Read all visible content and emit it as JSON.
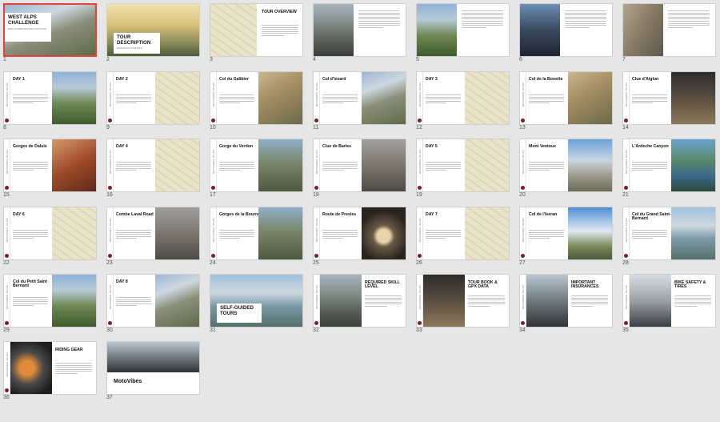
{
  "app": {
    "panel": "Slide Sorter"
  },
  "colors": {
    "accent": "#e8413a",
    "brand_dot": "#7a1f2b"
  },
  "brand_strip": "MOTOVIBES TOURS",
  "slides": [
    {
      "n": "1",
      "layout": "cover",
      "title": "WEST ALPS CHALLENGE",
      "sub": "SELF-GUIDED MOTORCYCLE TOUR",
      "photo": "mountain"
    },
    {
      "n": "2",
      "layout": "cover2",
      "title": "TOUR DESCRIPTION",
      "sub": "HIGHLIGHTS & DETAILS",
      "photo": "sunrise"
    },
    {
      "n": "3",
      "layout": "overview",
      "title": "TOUR OVERVIEW",
      "sub": "",
      "photo": "map"
    },
    {
      "n": "4",
      "layout": "photo-left",
      "title": "",
      "sub": "",
      "photo": "road"
    },
    {
      "n": "5",
      "layout": "photo-left",
      "title": "",
      "sub": "",
      "photo": "valley"
    },
    {
      "n": "6",
      "layout": "photo-left",
      "title": "",
      "sub": "",
      "photo": "portrait"
    },
    {
      "n": "7",
      "layout": "photo-left",
      "title": "",
      "sub": "",
      "photo": "cliff"
    },
    {
      "n": "8",
      "layout": "title-photo",
      "title": "DAY 1",
      "sub": "",
      "photo": "valley"
    },
    {
      "n": "9",
      "layout": "title-photo",
      "title": "DAY 2",
      "sub": "",
      "photo": "map"
    },
    {
      "n": "10",
      "layout": "title-photo",
      "title": "Col du Galibier",
      "sub": "",
      "photo": "serpentine"
    },
    {
      "n": "11",
      "layout": "title-photo",
      "title": "Col d'Izoard",
      "sub": "",
      "photo": "mountain"
    },
    {
      "n": "12",
      "layout": "title-photo",
      "title": "DAY 3",
      "sub": "",
      "photo": "map"
    },
    {
      "n": "13",
      "layout": "title-photo",
      "title": "Col de la Bonette",
      "sub": "",
      "photo": "serpentine"
    },
    {
      "n": "14",
      "layout": "title-photo",
      "title": "Clue d'Aiglun",
      "sub": "",
      "photo": "bike"
    },
    {
      "n": "15",
      "layout": "title-photo",
      "title": "Gorges de Daluis",
      "sub": "",
      "photo": "red"
    },
    {
      "n": "16",
      "layout": "title-photo",
      "title": "DAY 4",
      "sub": "",
      "photo": "map"
    },
    {
      "n": "17",
      "layout": "title-photo",
      "title": "Gorge du Verdon",
      "sub": "",
      "photo": "gorge"
    },
    {
      "n": "18",
      "layout": "title-photo",
      "title": "Clue de Barles",
      "sub": "",
      "photo": "rock"
    },
    {
      "n": "19",
      "layout": "title-photo",
      "title": "DAY 5",
      "sub": "",
      "photo": "map"
    },
    {
      "n": "20",
      "layout": "title-photo",
      "title": "Mont Ventoux",
      "sub": "",
      "photo": "ventoux"
    },
    {
      "n": "21",
      "layout": "title-photo",
      "title": "L'Ardeche Canyon",
      "sub": "",
      "photo": "canyon"
    },
    {
      "n": "22",
      "layout": "title-photo",
      "title": "DAY 6",
      "sub": "",
      "photo": "map"
    },
    {
      "n": "23",
      "layout": "title-photo",
      "title": "Combe Laval Road",
      "sub": "",
      "photo": "rock"
    },
    {
      "n": "24",
      "layout": "title-photo",
      "title": "Gorges de la Bourne",
      "sub": "",
      "photo": "gorge"
    },
    {
      "n": "25",
      "layout": "title-photo",
      "title": "Route de Presles",
      "sub": "",
      "photo": "tunnel"
    },
    {
      "n": "26",
      "layout": "title-photo",
      "title": "DAY 7",
      "sub": "",
      "photo": "map"
    },
    {
      "n": "27",
      "layout": "title-photo",
      "title": "Col de l'Iseran",
      "sub": "",
      "photo": "snow"
    },
    {
      "n": "28",
      "layout": "title-photo",
      "title": "Col du Grand Saint-Bernard",
      "sub": "",
      "photo": "lake"
    },
    {
      "n": "29",
      "layout": "title-photo",
      "title": "Col du Petit Saint Bernard",
      "sub": "",
      "photo": "valley"
    },
    {
      "n": "30",
      "layout": "title-photo",
      "title": "DAY 8",
      "sub": "",
      "photo": "mountain"
    },
    {
      "n": "31",
      "layout": "self",
      "title": "SELF-GUIDED TOURS",
      "sub": "",
      "photo": "lake"
    },
    {
      "n": "32",
      "layout": "photo-title",
      "title": "REQUIRED SKILL LEVEL",
      "sub": "",
      "photo": "road"
    },
    {
      "n": "33",
      "layout": "photo-title",
      "title": "TOUR BOOK & GPX DATA",
      "sub": "",
      "photo": "bike"
    },
    {
      "n": "34",
      "layout": "photo-title",
      "title": "IMPORTANT INSURANCES",
      "sub": "",
      "photo": "riders"
    },
    {
      "n": "35",
      "layout": "photo-title",
      "title": "BIKE SAFETY & TIRES",
      "sub": "",
      "photo": "bike2"
    },
    {
      "n": "36",
      "layout": "photo-title",
      "title": "RIDING GEAR",
      "sub": "",
      "photo": "helmet"
    },
    {
      "n": "37",
      "layout": "end",
      "title": "MotoVibes",
      "sub": "",
      "photo": "riders"
    }
  ]
}
